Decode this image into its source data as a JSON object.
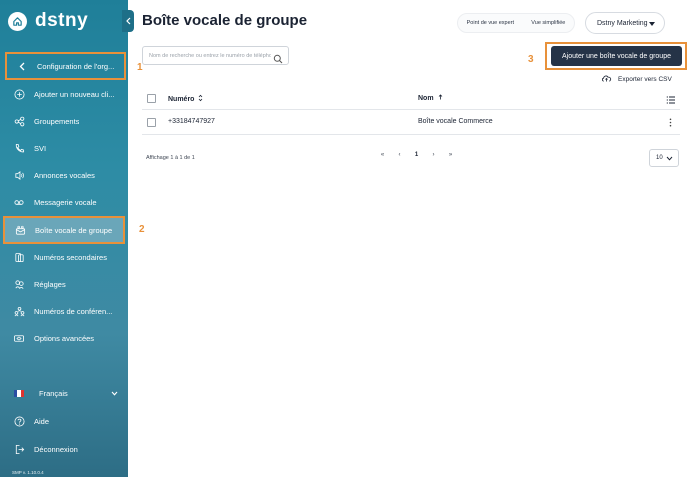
{
  "brand": {
    "name": "dstny"
  },
  "sidebar": {
    "back_item": {
      "label": "Configuration de l'org...",
      "icon": "chevron-left-icon"
    },
    "items": [
      {
        "label": "Ajouter un nouveau cli...",
        "icon": "plus-circle-icon"
      },
      {
        "label": "Groupements",
        "icon": "group-icon"
      },
      {
        "label": "SVI",
        "icon": "phone-menu-icon"
      },
      {
        "label": "Annonces vocales",
        "icon": "voice-announce-icon"
      },
      {
        "label": "Messagerie vocale",
        "icon": "voicemail-icon"
      },
      {
        "label": "Boîte vocale de groupe",
        "icon": "group-mailbox-icon"
      },
      {
        "label": "Numéros secondaires",
        "icon": "secondary-numbers-icon"
      },
      {
        "label": "Réglages",
        "icon": "settings-icon"
      },
      {
        "label": "Numéros de conféren...",
        "icon": "conference-icon"
      },
      {
        "label": "Options avancées",
        "icon": "advanced-options-icon"
      }
    ],
    "active_index": 5,
    "language": {
      "label": "Français"
    },
    "help_label": "Aide",
    "logout_label": "Déconnexion",
    "version": "SMP v. 1.10.0.4"
  },
  "markers": {
    "m1": "1",
    "m2": "2",
    "m3": "3"
  },
  "header": {
    "title": "Boîte vocale de groupe",
    "view_expert": "Point de vue expert",
    "view_simple": "Vue simplifiée",
    "org_name": "Dstny Marketing"
  },
  "toolbar": {
    "search_placeholder": "Nom de recherche ou entrez le numéro de téléphone",
    "add_label": "Ajouter une boîte vocale de groupe",
    "export_label": "Exporter vers CSV"
  },
  "table": {
    "columns": [
      "Numéro",
      "Nom"
    ],
    "rows": [
      {
        "number": "+33184747927",
        "name": "Boîte vocale Commerce"
      }
    ]
  },
  "pagination": {
    "info": "Affichage 1 à 1 de 1",
    "first": "«",
    "prev": "‹",
    "current": "1",
    "next": "›",
    "last": "»",
    "page_size": "10"
  },
  "colors": {
    "sidebar_top": "#1f7f99",
    "highlight": "#e8913a",
    "primary_button": "#253347",
    "active_item": "#6aa6b9"
  }
}
